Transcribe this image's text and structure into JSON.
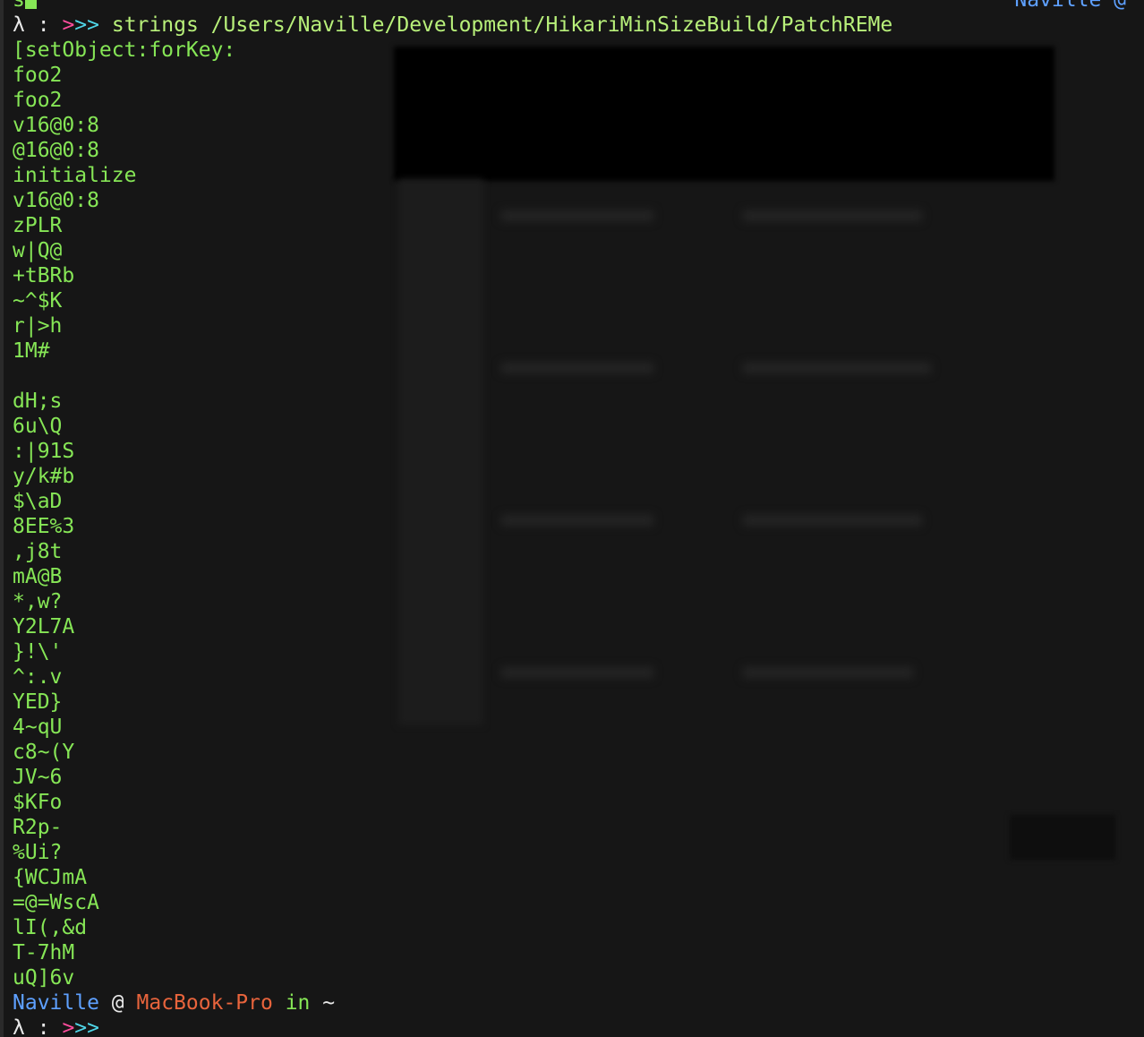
{
  "terminal": {
    "top_fragment": "s",
    "top_right_fragment": "Naville @",
    "command_prompt": {
      "lambda": "λ",
      "colon": ":",
      "arrows": ">>>",
      "command": "strings /Users/Naville/Development/HikariMinSizeBuild/PatchREMe"
    },
    "output_lines": [
      "[setObject:forKey:",
      "foo2",
      "foo2",
      "v16@0:8",
      "@16@0:8",
      "initialize",
      "v16@0:8",
      "zPLR",
      "w|Q@",
      "+tBRb",
      "~^$K",
      "r|>h",
      "1M#",
      "",
      "dH;s",
      "6u\\Q",
      ":|91S",
      "y/k#b",
      "$\\aD",
      "8EE%3",
      ",j8t",
      "mA@B",
      "*,w?",
      "Y2L7A",
      "}!\\'",
      "^:.v",
      "YED}",
      "4~qU",
      "c8~(Y",
      "JV~6",
      "$KFo",
      "R2p-",
      "%Ui?",
      "{WCJmA",
      "=@=WscA",
      "lI(,&d",
      "T-7hM",
      "uQ]6v"
    ],
    "status": {
      "user": "Naville",
      "at": "@",
      "host": "MacBook-Pro",
      "in": "in",
      "dir": "~"
    },
    "final_prompt": {
      "lambda": "λ",
      "colon": ":",
      "arrows": ">>>"
    }
  },
  "colors": {
    "background": "#161616",
    "output": "#86e656",
    "user": "#5ea0ff",
    "host": "#e8643c",
    "arrow_pink": "#ff4d9d",
    "arrow_cyan": "#4fd6e8"
  }
}
